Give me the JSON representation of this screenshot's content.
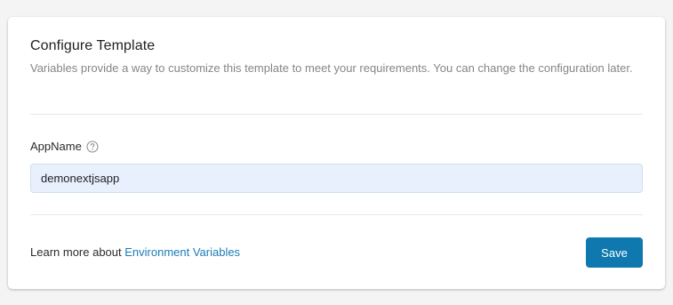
{
  "card": {
    "title": "Configure Template",
    "description": "Variables provide a way to customize this template to meet your requirements. You can change the configuration later."
  },
  "field": {
    "label": "AppName",
    "help_icon": "question-circle-icon",
    "value": "demonextjsapp"
  },
  "footer": {
    "prefix": "Learn more about ",
    "link_text": "Environment Variables",
    "save_label": "Save"
  },
  "colors": {
    "accent": "#0f79af",
    "link": "#1c7cb5",
    "input_background": "#e8f0fe"
  }
}
